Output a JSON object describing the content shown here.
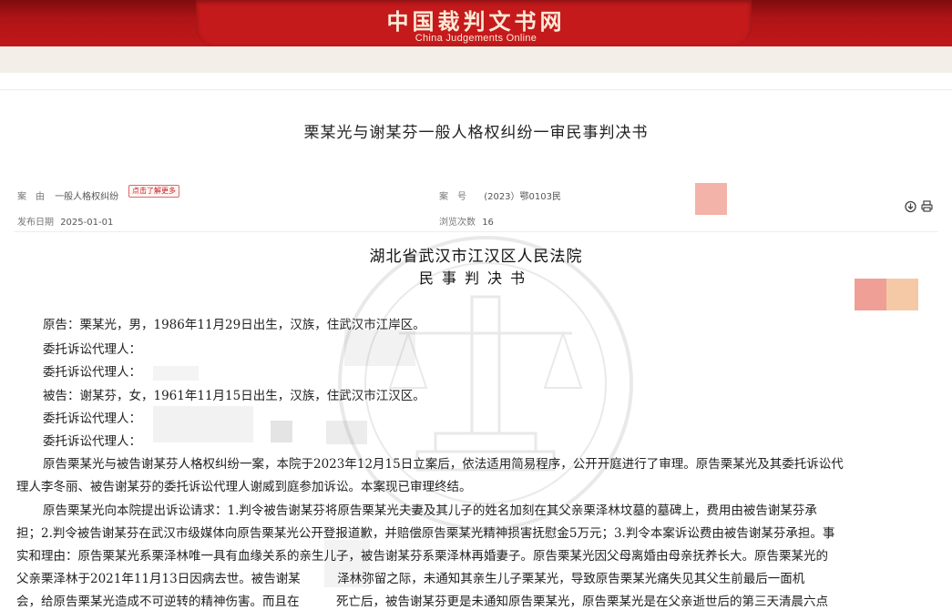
{
  "site": {
    "name_cn": "中国裁判文书网",
    "name_en": "China Judgements Online"
  },
  "document": {
    "title": "栗某光与谢某芬一般人格权纠纷一审民事判决书"
  },
  "meta": {
    "cause_label": "案　由",
    "cause_value": "一般人格权纠纷",
    "more_label": "点击了解更多",
    "case_no_label": "案　号",
    "case_no_value": "(2023）鄂0103民",
    "publish_label": "发布日期",
    "publish_value": "2025-01-01",
    "views_label": "浏览次数",
    "views_value": "16"
  },
  "actions": [
    {
      "name": "download-icon",
      "glyph": "⇩"
    },
    {
      "name": "print-icon",
      "glyph": "⎙"
    }
  ],
  "body": {
    "court": "湖北省武汉市江汉区人民法院",
    "doctype": "民事判决书",
    "lines": [
      "原告：栗某光，男，1986年11月29日出生，汉族，住武汉市江岸区。",
      "委托诉讼代理人：",
      "委托诉讼代理人：",
      "被告：谢某芬，女，1961年11月15日出生，汉族，住武汉市江汉区。",
      "委托诉讼代理人：",
      "委托诉讼代理人：",
      "原告栗某光与被告谢某芬人格权纠纷一案，本院于2023年12月15日立案后，依法适用简易程序，公开开庭进行了审理。原告栗某光及其委托诉讼代",
      "理人李冬丽、被告谢某芬的委托诉讼代理人谢威到庭参加诉讼。本案现已审理终结。",
      "原告栗某光向本院提出诉讼请求：1.判令被告谢某芬将原告栗某光夫妻及其儿子的姓名加刻在其父亲栗泽林坟墓的墓碑上，费用由被告谢某芬承",
      "担；2.判令被告谢某芬在武汉市级媒体向原告栗某光公开登报道歉，并赔偿原告栗某光精神损害抚慰金5万元；3.判令本案诉讼费由被告谢某芬承担。事",
      "实和理由：原告栗某光系栗泽林唯一具有血缘关系的亲生儿子，被告谢某芬系栗泽林再婚妻子。原告栗某光因父母离婚由母亲抚养长大。原告栗某光的",
      "父亲栗泽林于2021年11月13日因病去世。被告谢某　　　泽林弥留之际，未通知其亲生儿子栗某光，导致原告栗某光痛失见其父生前最后一面机",
      "会，给原告栗某光造成不可逆转的精神伤害。而且在　　　死亡后，被告谢某芬更是未通知原告栗某光，原告栗某光是在父亲逝世后的第三天清晨六点"
    ]
  },
  "colors": {
    "brand_red": "#c51a1c",
    "header_text": "#fbe9d6",
    "tag_red": "#c8201c",
    "redact_pink": "#f4b3a8",
    "redact_salmon": "#ef9f95",
    "redact_peach": "#f6c9a6"
  }
}
